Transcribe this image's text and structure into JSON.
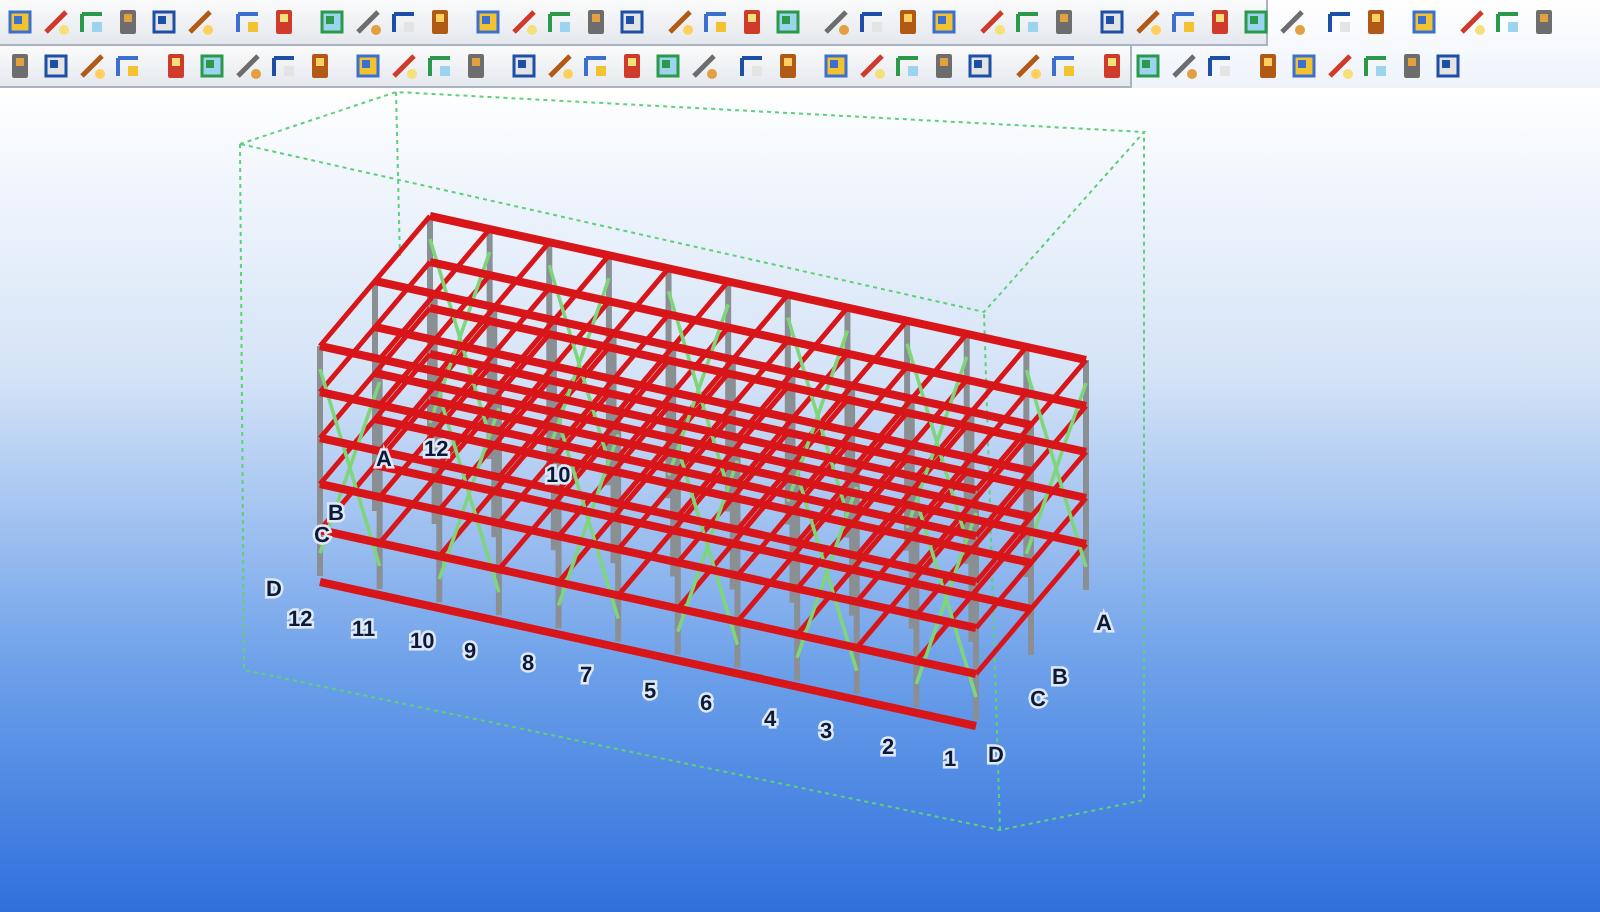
{
  "model_view": {
    "front_axis": [
      "12",
      "11",
      "10",
      "9",
      "8",
      "7",
      "5",
      "6",
      "4",
      "3",
      "2",
      "1"
    ],
    "left_axis": [
      "A",
      "B",
      "C",
      "D"
    ],
    "right_axis": [
      "A",
      "B",
      "C",
      "D"
    ],
    "interior_labels": [
      "12",
      "10"
    ]
  }
}
